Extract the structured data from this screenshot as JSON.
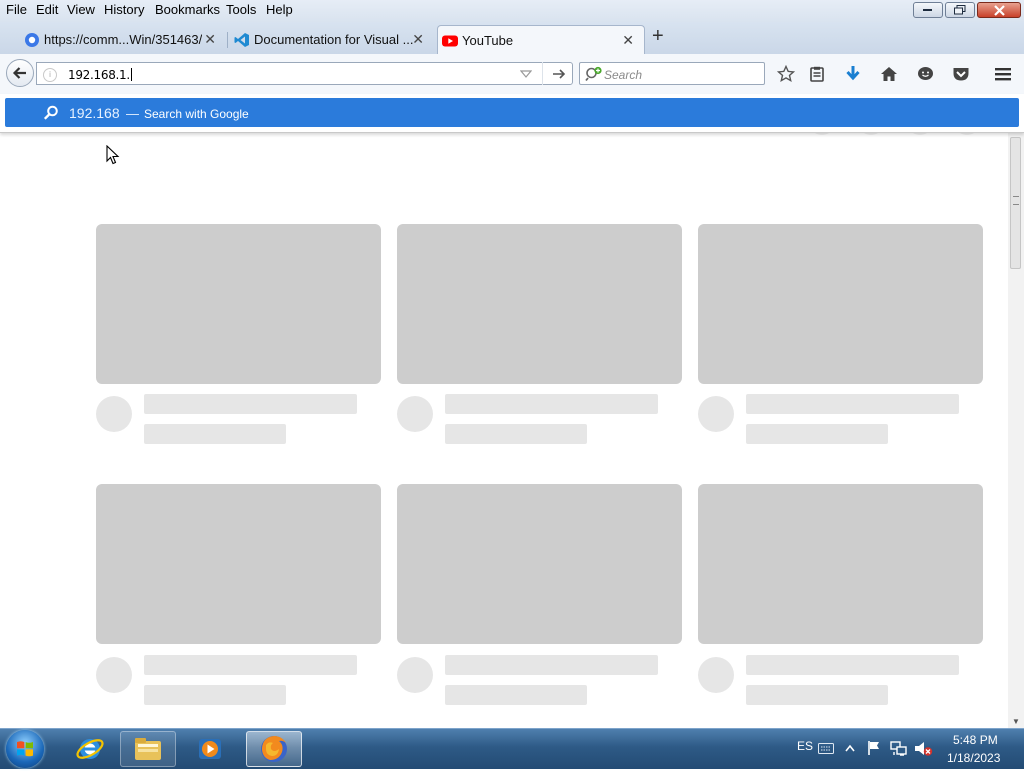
{
  "menubar": {
    "items": [
      "File",
      "Edit",
      "View",
      "History",
      "Bookmarks",
      "Tools",
      "Help"
    ]
  },
  "tabs": [
    {
      "label": "https://comm...Win/351463/",
      "icon": "globe-icon",
      "active": false
    },
    {
      "label": "Documentation for Visual ...",
      "icon": "vscode-icon",
      "active": false
    },
    {
      "label": "YouTube",
      "icon": "youtube-icon",
      "active": true
    }
  ],
  "navbar": {
    "url_value": "192.168.1.",
    "search_placeholder": "Search"
  },
  "suggestion": {
    "term": "192.168",
    "dash": "—",
    "action": "Search with Google"
  },
  "taskbar": {
    "language": "ES",
    "time": "5:48 PM",
    "date": "1/18/2023",
    "apps": [
      "internet-explorer-icon",
      "file-explorer-icon",
      "media-player-icon",
      "firefox-icon"
    ]
  },
  "colors": {
    "highlight": "#2b7bdb",
    "skeleton_thumb": "#cdcdcd",
    "skeleton_line": "#e6e6e6"
  }
}
